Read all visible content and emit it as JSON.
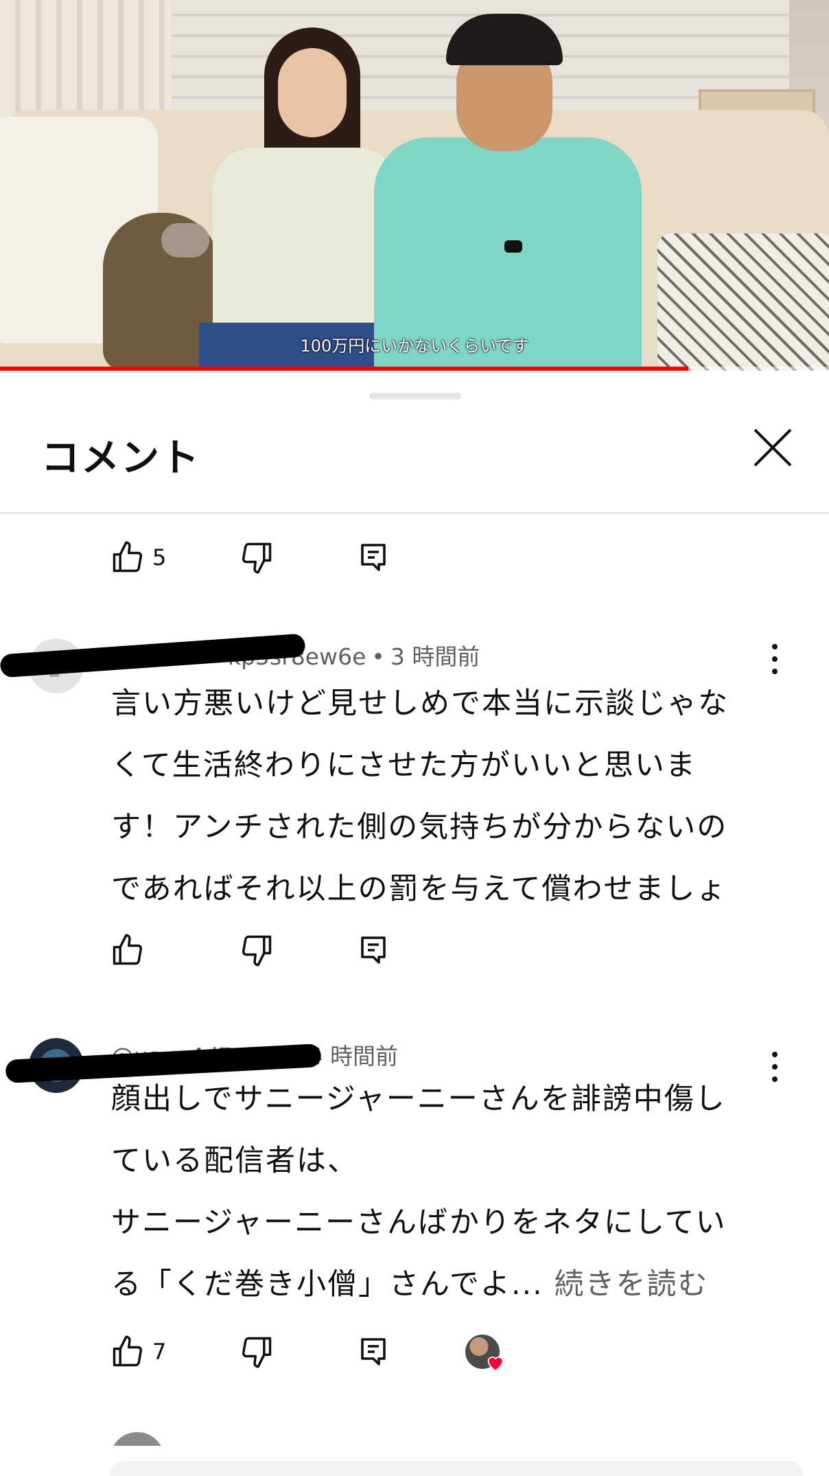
{
  "video": {
    "subtitle": "100万円にいかないくらいです",
    "progress_fraction": 0.83,
    "progress_color": "#ff0000"
  },
  "sheet": {
    "title": "コメント",
    "close_icon": "close-icon"
  },
  "top_actions": {
    "like_count": "5"
  },
  "comments": [
    {
      "handle": "@user-kp5sr8ew6e",
      "handle_visible": "kp5sr8ew6e",
      "separator": "•",
      "time": "3 時間前",
      "lines": [
        "言い方悪いけど見せしめで本当に示談じゃな",
        "くて生活終わりにさせた方がいいと思いま",
        "す！アンチされた側の気持ちが分からないの",
        "であればそれ以上の罰を与えて償わせましょ"
      ],
      "like_count": ""
    },
    {
      "handle": "@user-l4-j7ut1b",
      "handle_visible": "@us… 4  j7ut1b",
      "separator": "•",
      "time": "4 時間前",
      "lines": [
        "顔出しでサニージャーニーさんを誹謗中傷し",
        "ている配信者は、",
        "サニージャーニーさんばかりをネタにしてい",
        "る「くだ巻き小僧」さんでよ..."
      ],
      "read_more": "続きを読む",
      "like_count": "7"
    }
  ]
}
